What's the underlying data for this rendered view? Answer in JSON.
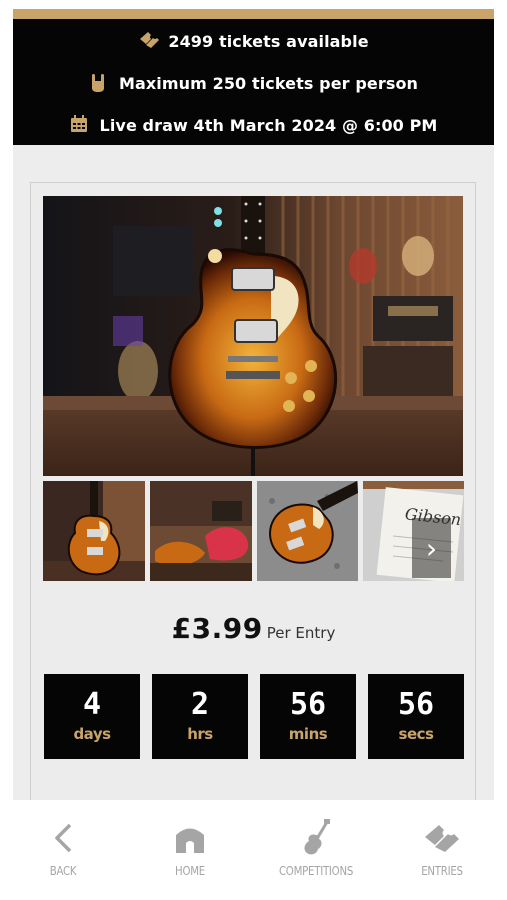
{
  "info": {
    "tickets_available": "2499 tickets available",
    "max_per_person": "Maximum 250 tickets per person",
    "live_draw": "Live draw 4th March 2024 @ 6:00 PM"
  },
  "icons": {
    "tickets": "tickets-icon",
    "rock_hand": "rock-hand-icon",
    "calendar": "calendar-icon",
    "next": "chevron-right-icon",
    "back": "chevron-left-icon",
    "home": "home-icon",
    "competitions": "guitar-icon",
    "entries": "tickets-icon"
  },
  "colors": {
    "accent_gold": "#c8a46a",
    "banner_black": "#050505",
    "nav_grey": "#a5a5a5"
  },
  "gallery": {
    "next_symbol": "›"
  },
  "product": {
    "price": "£3.99",
    "per_entry": "Per Entry"
  },
  "countdown": [
    {
      "value": "4",
      "unit": "days"
    },
    {
      "value": "2",
      "unit": "hrs"
    },
    {
      "value": "56",
      "unit": "mins"
    },
    {
      "value": "56",
      "unit": "secs"
    }
  ],
  "nav": {
    "back": "BACK",
    "home": "HOME",
    "competitions": "COMPETITIONS",
    "entries": "ENTRIES"
  }
}
